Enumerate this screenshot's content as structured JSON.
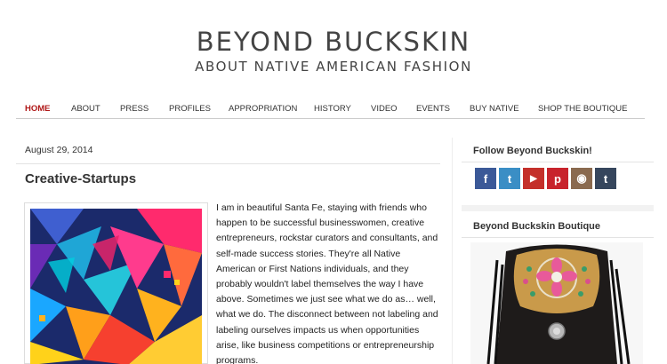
{
  "site": {
    "title": "BEYOND BUCKSKIN",
    "tagline": "ABOUT NATIVE AMERICAN FASHION"
  },
  "nav": {
    "items": [
      {
        "label": "HOME",
        "active": true
      },
      {
        "label": "ABOUT"
      },
      {
        "label": "PRESS"
      },
      {
        "label": "PROFILES"
      },
      {
        "label": "APPROPRIATION"
      },
      {
        "label": "HISTORY"
      },
      {
        "label": "VIDEO"
      },
      {
        "label": "EVENTS"
      },
      {
        "label": "BUY NATIVE"
      },
      {
        "label": "SHOP THE BOUTIQUE"
      }
    ]
  },
  "post": {
    "date": "August 29, 2014",
    "title": "Creative-Startups",
    "body": "I am in beautiful Santa Fe, staying with friends who happen to be successful businesswomen, creative entrepreneurs, rockstar curators and consultants, and self-made success stories. They're all Native American or First Nations individuals, and they probably wouldn't label themselves the way I have above. Sometimes we just see what we do as… well, what we do. The disconnect between not labeling and labeling ourselves impacts us when opportunities arise, like business competitions or entrepreneurship programs."
  },
  "sidebar": {
    "follow_title": "Follow Beyond Buckskin!",
    "social": [
      {
        "icon": "facebook-icon",
        "glyph": "f",
        "color": "#3b5998"
      },
      {
        "icon": "twitter-icon",
        "glyph": "t",
        "color": "#3a8ec5"
      },
      {
        "icon": "youtube-icon",
        "glyph": "▶",
        "color": "#c4302b"
      },
      {
        "icon": "pinterest-icon",
        "glyph": "p",
        "color": "#c8232c"
      },
      {
        "icon": "instagram-icon",
        "glyph": "◉",
        "color": "#8a6a4f"
      },
      {
        "icon": "tumblr-icon",
        "glyph": "t",
        "color": "#36465d"
      }
    ],
    "boutique_title": "Beyond Buckskin Boutique"
  },
  "colors": {
    "nav_active": "#b01919",
    "text": "#222222"
  }
}
